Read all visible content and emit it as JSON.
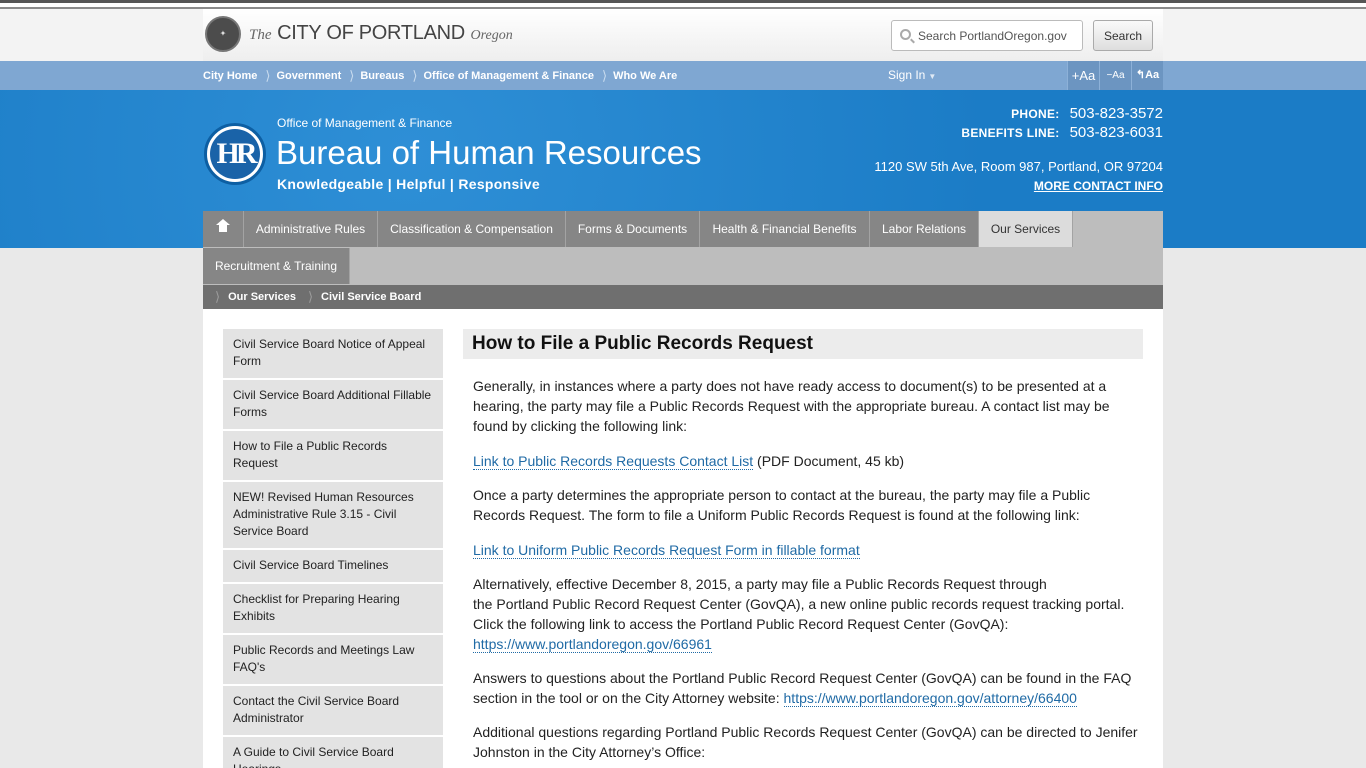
{
  "header": {
    "the": "The",
    "city": "CITY OF PORTLAND",
    "oregon": "Oregon",
    "search_placeholder": "Search PortlandOregon.gov",
    "search_button": "Search"
  },
  "city_nav": {
    "crumbs": [
      "City Home",
      "Government",
      "Bureaus",
      "Office of Management & Finance",
      "Who We Are"
    ],
    "sign_in": "Sign In",
    "font_tools": [
      "+Aa",
      "−Aa",
      "↰Aa"
    ]
  },
  "banner": {
    "logo": "HR",
    "office": "Office of Management & Finance",
    "title": "Bureau of Human Resources",
    "tagline": "Knowledgeable | Helpful | Responsive",
    "phone_label": "PHONE:",
    "phone": "503-823-3572",
    "benefits_label": "BENEFITS LINE:",
    "benefits": "503-823-6031",
    "address": "1120 SW 5th Ave, Room 987, Portland, OR 97204",
    "more_contact": "MORE CONTACT INFO"
  },
  "main_nav": {
    "tabs": [
      "Administrative Rules",
      "Classification & Compensation",
      "Forms & Documents",
      "Health & Financial Benefits",
      "Labor Relations",
      "Our Services",
      "Recruitment & Training"
    ],
    "active": "Our Services"
  },
  "sub_crumbs": [
    "Our Services",
    "Civil Service Board"
  ],
  "side_nav": {
    "items": [
      "Civil Service Board Notice of Appeal Form",
      "Civil Service Board Additional Fillable Forms",
      "How to File a Public Records Request",
      "NEW! Revised Human Resources Administrative Rule 3.15 - Civil Service Board",
      "Civil Service Board Timelines",
      "Checklist for Preparing Hearing Exhibits",
      "Public Records and Meetings Law FAQ's",
      "Contact the Civil Service Board Administrator",
      "A Guide to Civil Service Board Hearings"
    ]
  },
  "content": {
    "title": "How to File a Public Records Request",
    "p1": "Generally, in instances where a party does not have ready access to document(s) to be presented at a hearing, the party may file a Public Records Request with the appropriate bureau.   A contact list may be found by clicking the following link:",
    "link1": "Link to Public Records Requests Contact List",
    "link1_meta": " (PDF Document, 45 kb)",
    "p2": "Once a party determines the appropriate person to contact at the bureau, the party may file a Public Records Request. The form to file a Uniform Public Records Request is found at the following link:",
    "link2": "Link to Uniform Public Records Request Form in fillable format",
    "p3_line1": "Alternatively, effective December 8, 2015, a party may file a Public Records Request through",
    "p3_rest": "the Portland Public Record Request Center (GovQA), a new online public records request tracking portal.  Click the following link to access the Portland Public Record Request Center (GovQA):",
    "link3": "https://www.portlandoregon.gov/66961",
    "p4": "Answers to questions about the Portland Public Record Request Center (GovQA) can be found in the FAQ section in the tool or on the City Attorney website:",
    "link4": "https://www.portlandoregon.gov/attorney/66400",
    "p5": " Additional questions regarding Portland Public Records Request Center (GovQA) can be directed to Jenifer Johnston in the City Attorney’s Office:"
  }
}
